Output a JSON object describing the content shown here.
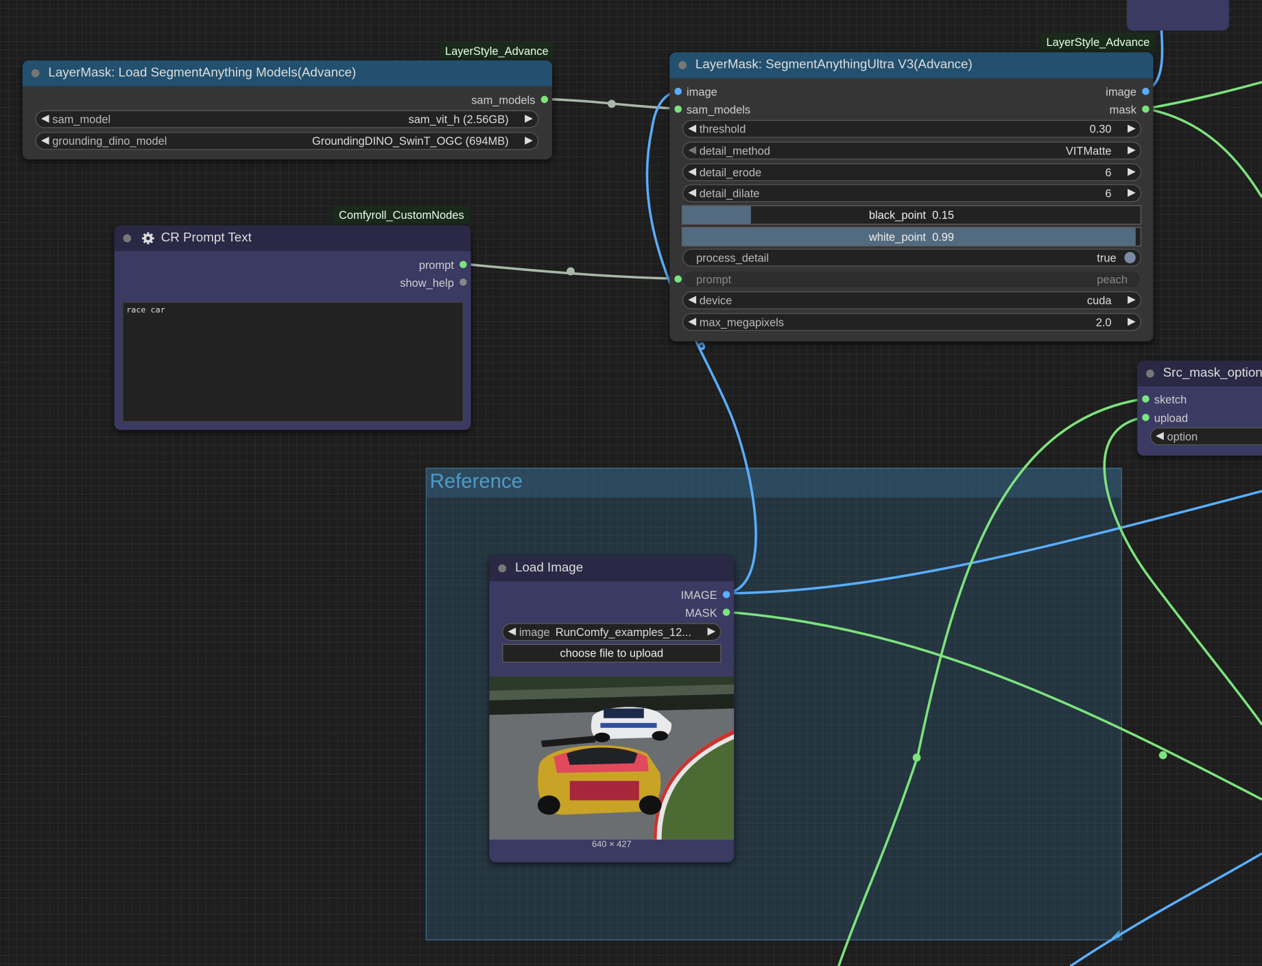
{
  "groups": {
    "reference_title": "Reference"
  },
  "node_sam_loader": {
    "badge": "LayerStyle_Advance",
    "title": "LayerMask: Load SegmentAnything Models(Advance)",
    "outputs": [
      "sam_models"
    ],
    "widgets": [
      {
        "label": "sam_model",
        "value": "sam_vit_h (2.56GB)"
      },
      {
        "label": "grounding_dino_model",
        "value": "GroundingDINO_SwinT_OGC (694MB)"
      }
    ]
  },
  "node_cr_prompt": {
    "badge": "Comfyroll_CustomNodes",
    "title": "CR Prompt Text",
    "outputs": [
      "prompt",
      "show_help"
    ],
    "text": "race car"
  },
  "node_sam_ultra": {
    "badge": "LayerStyle_Advance",
    "title": "LayerMask: SegmentAnythingUltra V3(Advance)",
    "inputs": [
      "image",
      "sam_models"
    ],
    "outputs": [
      "image",
      "mask"
    ],
    "threshold": {
      "label": "threshold",
      "value": "0.30"
    },
    "detail_method": {
      "label": "detail_method",
      "value": "VITMatte"
    },
    "detail_erode": {
      "label": "detail_erode",
      "value": "6"
    },
    "detail_dilate": {
      "label": "detail_dilate",
      "value": "6"
    },
    "black_point": {
      "label": "black_point",
      "value": "0.15",
      "fraction": 0.15
    },
    "white_point": {
      "label": "white_point",
      "value": "0.99",
      "fraction": 0.99
    },
    "process_detail": {
      "label": "process_detail",
      "value": "true"
    },
    "prompt": {
      "label": "prompt",
      "value": "peach"
    },
    "device": {
      "label": "device",
      "value": "cuda"
    },
    "max_megapixels": {
      "label": "max_megapixels",
      "value": "2.0"
    }
  },
  "node_src_mask": {
    "title": "Src_mask_option",
    "inputs": [
      "sketch",
      "upload"
    ],
    "widget_label": "option"
  },
  "node_load_image": {
    "title": "Load Image",
    "outputs": [
      "IMAGE",
      "MASK"
    ],
    "image_widget": {
      "label": "image",
      "value": "RunComfy_examples_12..."
    },
    "upload_button": "choose file to upload",
    "dimensions": "640 × 427"
  },
  "colors": {
    "link_green": "#7ce47c",
    "link_blue": "#5aaeff",
    "link_gray": "#a9b8a9",
    "title_blue": "#22506e",
    "node_purple": "#3b3a63"
  }
}
